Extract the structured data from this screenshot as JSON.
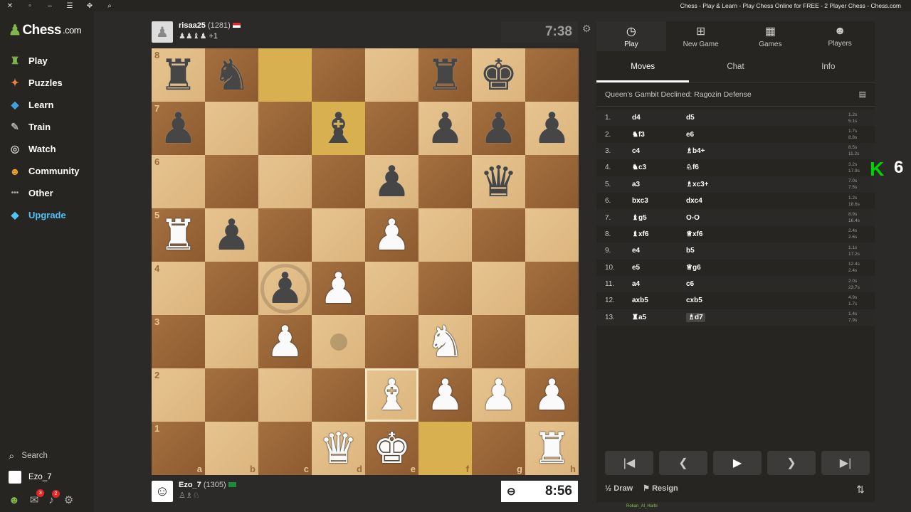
{
  "titlebar": {
    "title": "Chess - Play & Learn - Play Chess Online for FREE - 2 Player Chess - Chess.com"
  },
  "brand": {
    "logo_text": "Chess",
    "logo_suffix": ".com"
  },
  "nav": {
    "items": [
      {
        "label": "Play",
        "icon": "play-icon",
        "glyph": "♜"
      },
      {
        "label": "Puzzles",
        "icon": "puzzle-icon",
        "glyph": "✦"
      },
      {
        "label": "Learn",
        "icon": "learn-icon",
        "glyph": "◆"
      },
      {
        "label": "Train",
        "icon": "train-icon",
        "glyph": "✎"
      },
      {
        "label": "Watch",
        "icon": "binoculars-icon",
        "glyph": "◎"
      },
      {
        "label": "Community",
        "icon": "community-icon",
        "glyph": "☻"
      },
      {
        "label": "Other",
        "icon": "more-icon",
        "glyph": "•••"
      },
      {
        "label": "Upgrade",
        "icon": "diamond-icon",
        "glyph": "◆"
      }
    ],
    "search_label": "Search",
    "username": "Ezo_7",
    "mail_count": "3",
    "notif_count": "2"
  },
  "top_player": {
    "name": "risaa25",
    "rating": "(1281)",
    "captured": "♟♟♝♟ +1",
    "clock": "7:38"
  },
  "bottom_player": {
    "name": "Ezo_7",
    "rating": "(1305)",
    "captured": "♙♗♘",
    "clock": "8:56"
  },
  "board": {
    "ranks": [
      "8",
      "7",
      "6",
      "5",
      "4",
      "3",
      "2",
      "1"
    ],
    "files": [
      "a",
      "b",
      "c",
      "d",
      "e",
      "f",
      "g",
      "h"
    ],
    "position": [
      [
        "bR",
        "bN",
        "",
        "",
        "",
        "bR",
        "bK",
        ""
      ],
      [
        "bP",
        "",
        "",
        "bB",
        "",
        "bP",
        "bP",
        "bP"
      ],
      [
        "",
        "",
        "",
        "",
        "bP",
        "",
        "bQ",
        ""
      ],
      [
        "wR",
        "bP",
        "",
        "",
        "wP",
        "",
        "",
        ""
      ],
      [
        "",
        "",
        "bP",
        "wP",
        "",
        "",
        "",
        ""
      ],
      [
        "",
        "",
        "wP",
        "",
        "",
        "wN",
        "",
        ""
      ],
      [
        "",
        "",
        "",
        "",
        "wB",
        "wP",
        "wP",
        "wP"
      ],
      [
        "",
        "",
        "",
        "wQ",
        "wK",
        "",
        "",
        "wR"
      ]
    ]
  },
  "panel": {
    "tabs": [
      {
        "label": "Play",
        "icon": "stopwatch-icon",
        "glyph": "◷"
      },
      {
        "label": "New Game",
        "icon": "plus-icon",
        "glyph": "⊞"
      },
      {
        "label": "Games",
        "icon": "board-icon",
        "glyph": "▦"
      },
      {
        "label": "Players",
        "icon": "players-icon",
        "glyph": "☻"
      }
    ],
    "subtabs": [
      "Moves",
      "Chat",
      "Info"
    ],
    "opening": "Queen's Gambit Declined: Ragozin Defense",
    "moves": [
      {
        "n": "1.",
        "w": "d4",
        "b": "d5",
        "tw": "1.2s",
        "tb": "5.1s"
      },
      {
        "n": "2.",
        "w": "♞f3",
        "b": "e6",
        "tw": "1.7s",
        "tb": "8.8s"
      },
      {
        "n": "3.",
        "w": "c4",
        "b": "♗b4+",
        "tw": "8.5s",
        "tb": "11.2s"
      },
      {
        "n": "4.",
        "w": "♞c3",
        "b": "♘f6",
        "tw": "3.2s",
        "tb": "17.9s"
      },
      {
        "n": "5.",
        "w": "a3",
        "b": "♗xc3+",
        "tw": "7.0s",
        "tb": "7.5s"
      },
      {
        "n": "6.",
        "w": "bxc3",
        "b": "dxc4",
        "tw": "1.2s",
        "tb": "18.6s"
      },
      {
        "n": "7.",
        "w": "♝g5",
        "b": "O-O",
        "tw": "8.9s",
        "tb": "16.4s"
      },
      {
        "n": "8.",
        "w": "♝xf6",
        "b": "♕xf6",
        "tw": "2.4s",
        "tb": "2.6s"
      },
      {
        "n": "9.",
        "w": "e4",
        "b": "b5",
        "tw": "1.1s",
        "tb": "17.2s"
      },
      {
        "n": "10.",
        "w": "e5",
        "b": "♕g6",
        "tw": "12.4s",
        "tb": "2.4s"
      },
      {
        "n": "11.",
        "w": "a4",
        "b": "c6",
        "tw": "2.0s",
        "tb": "23.7s"
      },
      {
        "n": "12.",
        "w": "axb5",
        "b": "cxb5",
        "tw": "4.9s",
        "tb": "1.7s"
      },
      {
        "n": "13.",
        "w": "♜a5",
        "b": "♗d7",
        "tw": "1.4s",
        "tb": "7.9s"
      }
    ],
    "draw_label": "Draw",
    "resign_label": "Resign"
  },
  "overlay": {
    "k": "K",
    "six": "6",
    "footer_user": "Rokan_Al_Harbi"
  }
}
